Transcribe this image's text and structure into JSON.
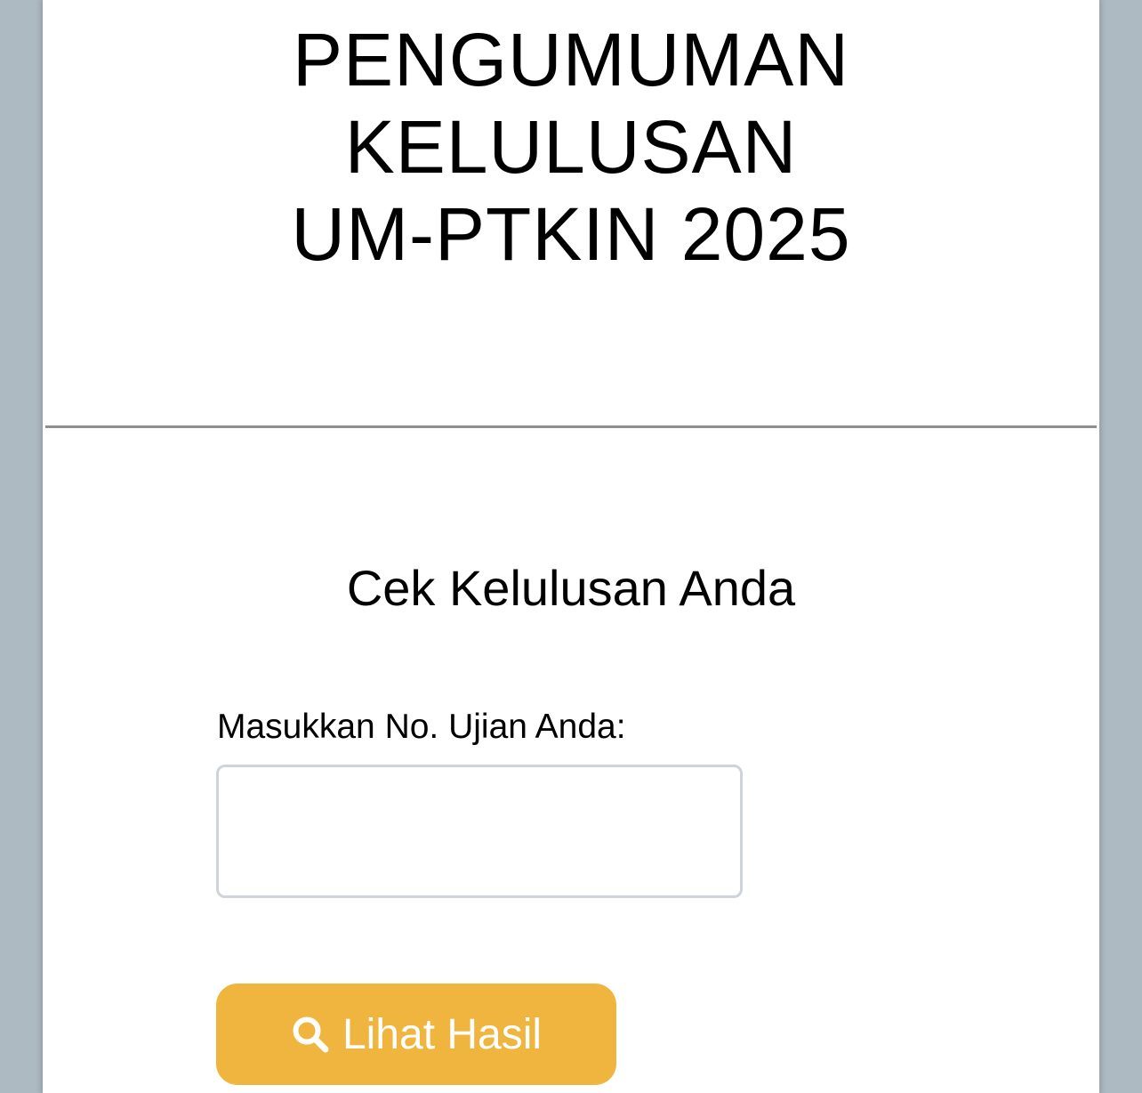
{
  "header": {
    "title_lines": [
      "PENGUMUMAN",
      "KELULUSAN",
      "UM-PTKIN 2025"
    ]
  },
  "form": {
    "heading": "Cek Kelulusan Anda",
    "exam_number_label": "Masukkan No. Ujian Anda:",
    "exam_number_value": "",
    "exam_number_placeholder": "",
    "submit_label": "Lihat Hasil",
    "submit_icon": "search-icon"
  },
  "colors": {
    "page_background": "#aebac2",
    "card_background": "#ffffff",
    "button_accent": "#f0b53f",
    "divider": "#8e8e8e",
    "input_border": "#ced4da"
  }
}
